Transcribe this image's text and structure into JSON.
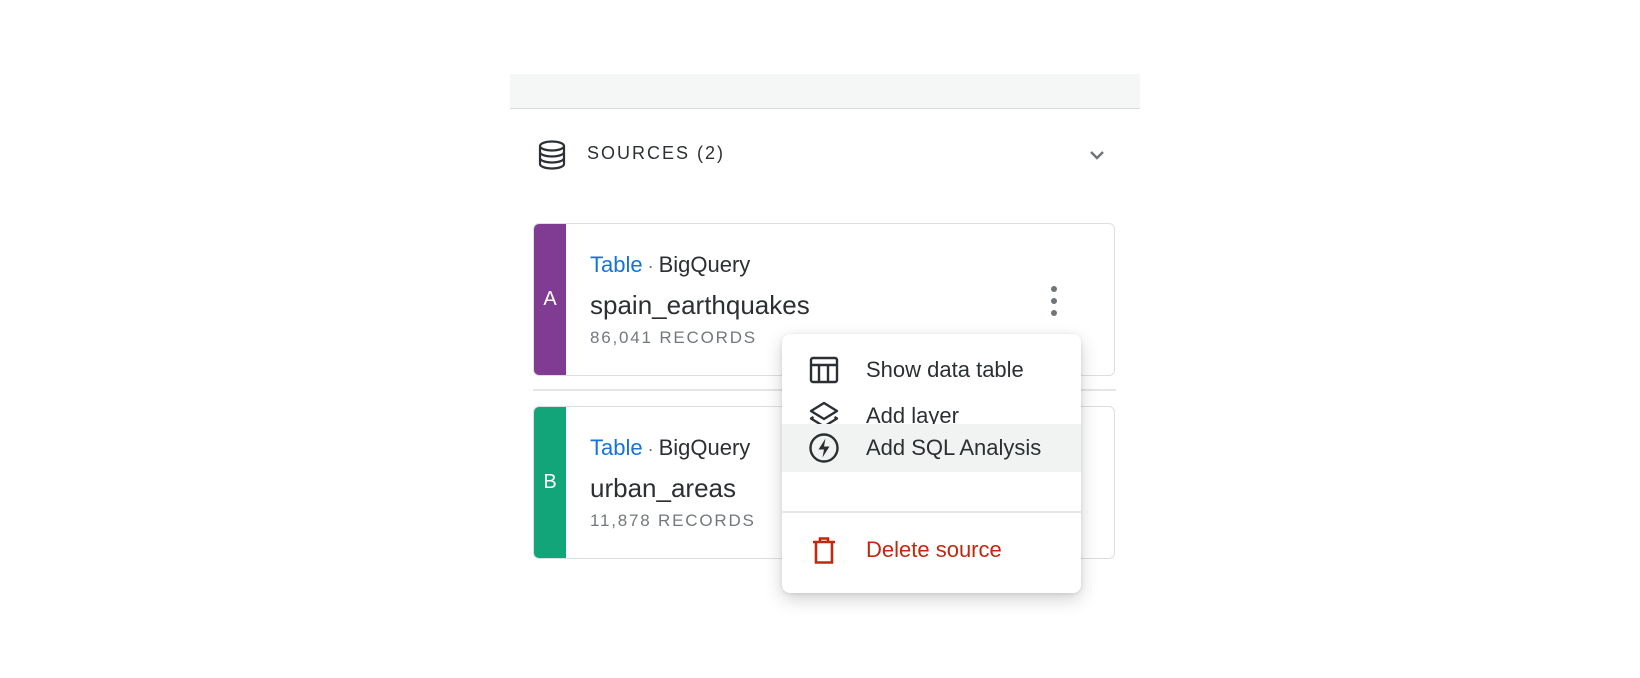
{
  "sources": {
    "title": "SOURCES (2)",
    "items": [
      {
        "letter": "A",
        "color": "#7f3c92",
        "type": "Table",
        "separator": "·",
        "provider": "BigQuery",
        "name": "spain_earthquakes",
        "records": "86,041 RECORDS"
      },
      {
        "letter": "B",
        "color": "#13a57a",
        "type": "Table",
        "separator": "·",
        "provider": "BigQuery",
        "name": "urban_areas",
        "records": "11,878 RECORDS"
      }
    ]
  },
  "menu": {
    "items": [
      {
        "label": "Show data table",
        "icon": "table-icon"
      },
      {
        "label": "Add layer",
        "icon": "layers-icon"
      },
      {
        "label": "Add SQL Analysis",
        "icon": "lightning-icon",
        "highlighted": true
      },
      {
        "label": "Delete source",
        "icon": "trash-icon",
        "danger": true
      }
    ]
  },
  "colors": {
    "accent_link": "#1673d8",
    "danger": "#c1290f"
  }
}
